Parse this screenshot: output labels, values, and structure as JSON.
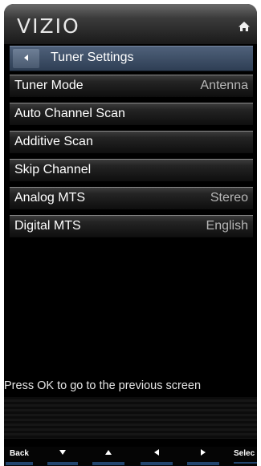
{
  "header": {
    "brand": "VIZIO",
    "home_icon": "home-icon"
  },
  "title_bar": {
    "back_icon": "triangle-left-icon",
    "title": "Tuner Settings"
  },
  "menu": {
    "items": [
      {
        "label": "Tuner Mode",
        "value": "Antenna"
      },
      {
        "label": "Auto Channel Scan",
        "value": ""
      },
      {
        "label": "Additive Scan",
        "value": ""
      },
      {
        "label": "Skip Channel",
        "value": ""
      },
      {
        "label": "Analog MTS",
        "value": "Stereo"
      },
      {
        "label": "Digital MTS",
        "value": "English"
      }
    ]
  },
  "hint": "Press OK to go to the previous screen",
  "bottom_keys": [
    {
      "label": "Back",
      "icon": ""
    },
    {
      "label": "",
      "icon": "arrow-down-icon"
    },
    {
      "label": "",
      "icon": "arrow-up-icon"
    },
    {
      "label": "",
      "icon": "arrow-left-icon"
    },
    {
      "label": "",
      "icon": "arrow-right-icon"
    },
    {
      "label": "Selec",
      "icon": ""
    }
  ],
  "colors": {
    "title_bar": "#3b4b63",
    "accent_blue": "#23456e",
    "value_text": "#b8b8b8"
  }
}
